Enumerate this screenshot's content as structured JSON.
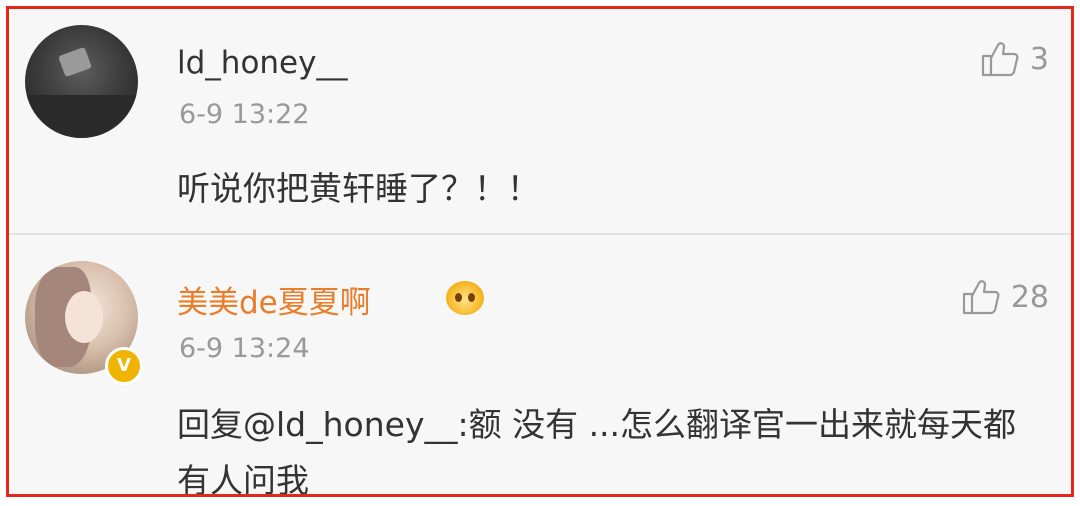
{
  "comments": [
    {
      "username": "ld_honey__",
      "timestamp": "6-9 13:22",
      "content": "听说你把黄轩睡了？！！",
      "likes": "3",
      "like_icon": "thumbs-up-icon"
    },
    {
      "username": "美美de夏夏啊",
      "timestamp": "6-9 13:24",
      "content": "回复@ld_honey__:额 没有 ...怎么翻译官一出来就每天都有人问我",
      "likes": "28",
      "like_icon": "thumbs-up-icon",
      "badge": "V",
      "badge_color": "#f0b400",
      "username_color": "#e87d2b"
    }
  ],
  "colors": {
    "frame_border": "#e8271b",
    "background": "#f7f7f7",
    "timestamp": "#999999"
  }
}
